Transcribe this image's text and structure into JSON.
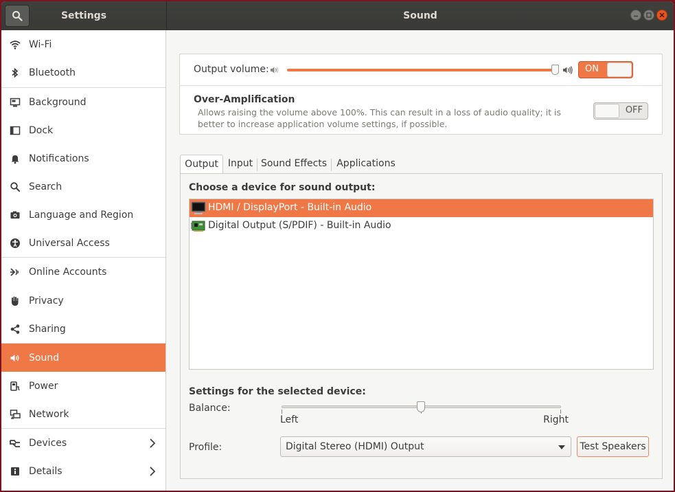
{
  "window": {
    "left_title": "Settings",
    "center_title": "Sound",
    "buttons": [
      "minimize",
      "maximize",
      "close"
    ]
  },
  "sidebar": {
    "items": [
      {
        "label": "Wi-Fi",
        "icon": "wifi-icon"
      },
      {
        "label": "Bluetooth",
        "icon": "bluetooth-icon"
      },
      {
        "label": "Background",
        "icon": "background-icon"
      },
      {
        "label": "Dock",
        "icon": "dock-icon"
      },
      {
        "label": "Notifications",
        "icon": "bell-icon"
      },
      {
        "label": "Search",
        "icon": "search-icon"
      },
      {
        "label": "Language and Region",
        "icon": "camera-icon"
      },
      {
        "label": "Universal Access",
        "icon": "accessibility-icon"
      },
      {
        "label": "Online Accounts",
        "icon": "online-accounts-icon"
      },
      {
        "label": "Privacy",
        "icon": "hand-icon"
      },
      {
        "label": "Sharing",
        "icon": "share-icon"
      },
      {
        "label": "Sound",
        "icon": "speaker-icon",
        "active": true
      },
      {
        "label": "Power",
        "icon": "power-icon"
      },
      {
        "label": "Network",
        "icon": "network-icon"
      },
      {
        "label": "Devices",
        "icon": "devices-icon",
        "has_submenu": true
      },
      {
        "label": "Details",
        "icon": "info-icon",
        "has_submenu": true
      }
    ]
  },
  "output_volume": {
    "label": "Output volume:",
    "level": 0.95,
    "toggle": "ON"
  },
  "over_amplification": {
    "title": "Over-Amplification",
    "description": "Allows raising the volume above 100%. This can result in a loss of audio quality; it is better to increase application volume settings, if possible.",
    "toggle": "OFF"
  },
  "tabs": [
    {
      "label": "Output",
      "active": true
    },
    {
      "label": "Input"
    },
    {
      "label": "Sound Effects"
    },
    {
      "label": "Applications"
    }
  ],
  "output": {
    "device_heading": "Choose a device for sound output:",
    "devices": [
      {
        "label": "HDMI / DisplayPort - Built-in Audio",
        "selected": true,
        "icon": "monitor-icon"
      },
      {
        "label": "Digital Output (S/PDIF) - Built-in Audio",
        "selected": false,
        "icon": "sound-card-icon"
      }
    ],
    "settings_heading": "Settings for the selected device:",
    "balance": {
      "label": "Balance:",
      "left": "Left",
      "right": "Right",
      "value": 0.5
    },
    "profile": {
      "label": "Profile:",
      "value": "Digital Stereo (HDMI) Output"
    },
    "test_button": "Test Speakers"
  },
  "colors": {
    "accent": "#f07746",
    "titlebar": "#3c3c39",
    "sidebar_bg": "#ffffff"
  }
}
